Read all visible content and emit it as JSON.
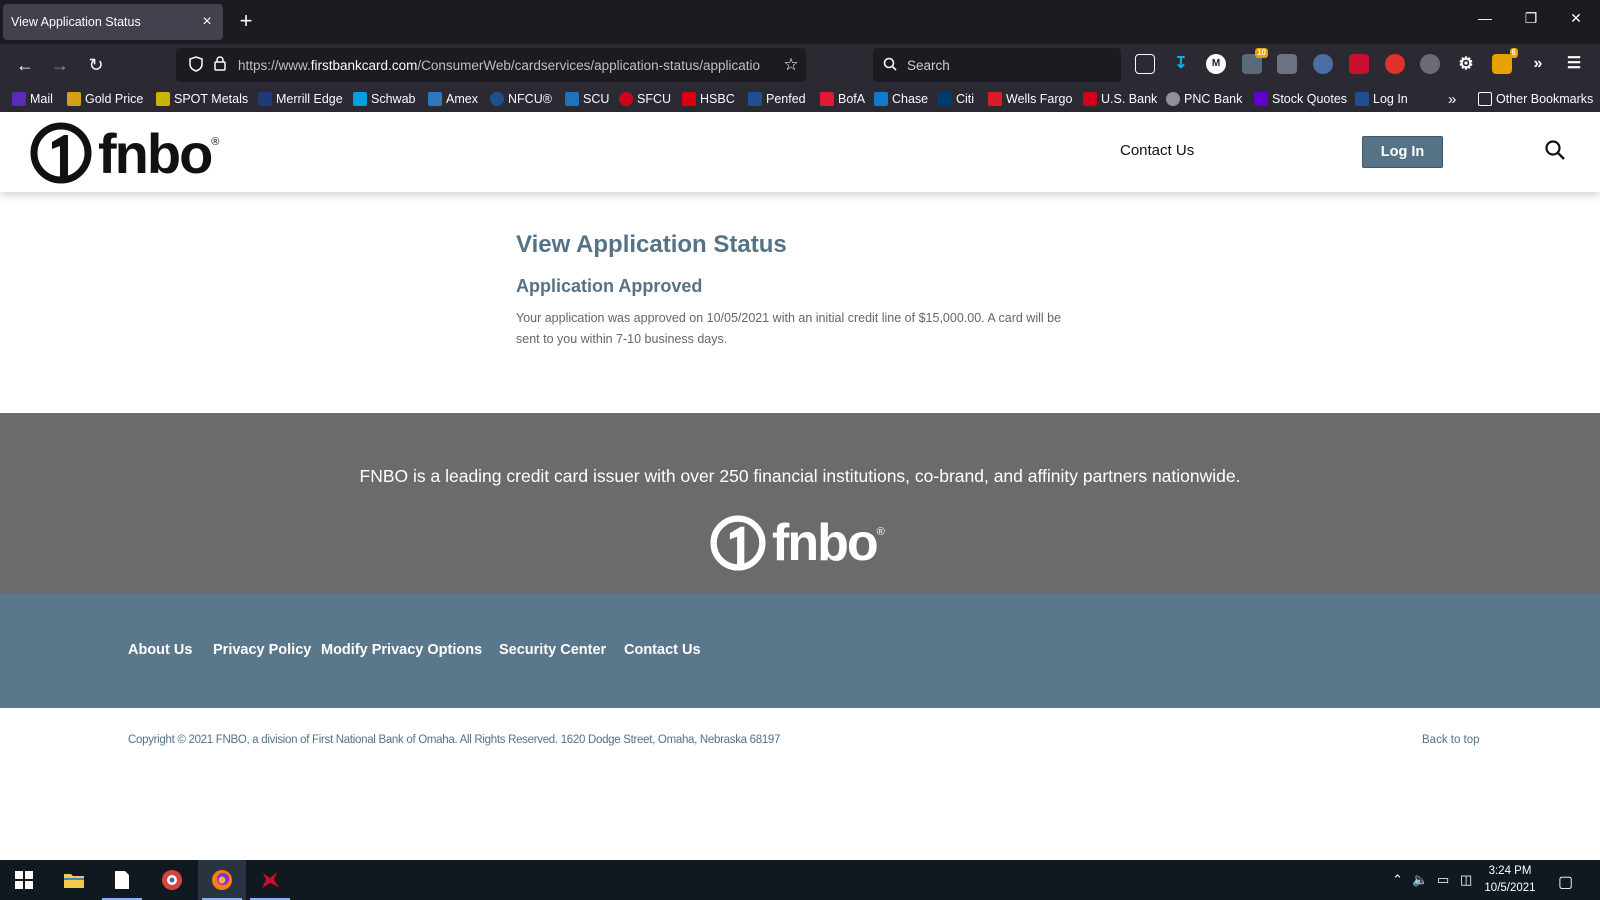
{
  "browser": {
    "tab_title": "View Application Status",
    "tab_close": "×",
    "new_tab": "+",
    "url_prefix": "https://www.",
    "url_host": "firstbankcard.com",
    "url_path": "/ConsumerWeb/cardservices/application-status/applicatio",
    "search_placeholder": "Search",
    "ext_badges": {
      "weather": "10",
      "store": "6"
    },
    "bookmarks": [
      {
        "label": "Mail",
        "color": "#5b2ab8"
      },
      {
        "label": "Gold Price",
        "color": "#d4a017"
      },
      {
        "label": "SPOT Metals",
        "color": "#c9b400"
      },
      {
        "label": "Merrill Edge",
        "color": "#1f3a7a"
      },
      {
        "label": "Schwab",
        "color": "#00a0df"
      },
      {
        "label": "Amex",
        "color": "#2e77bc"
      },
      {
        "label": "NFCU®",
        "color": "#1d4f91"
      },
      {
        "label": "SCU",
        "color": "#1e73be"
      },
      {
        "label": "SFCU",
        "color": "#d0021b"
      },
      {
        "label": "HSBC",
        "color": "#db0011"
      },
      {
        "label": "Penfed",
        "color": "#1d4f91"
      },
      {
        "label": "BofA",
        "color": "#e31837"
      },
      {
        "label": "Chase",
        "color": "#117aca"
      },
      {
        "label": "Citi",
        "color": "#003b70"
      },
      {
        "label": "Wells Fargo",
        "color": "#d71e28"
      },
      {
        "label": "U.S. Bank",
        "color": "#d0021b"
      },
      {
        "label": "PNC Bank",
        "color": "#8f8f9d"
      },
      {
        "label": "Stock Quotes",
        "color": "#6001d2"
      },
      {
        "label": "Log In",
        "color": "#1d4f91"
      }
    ],
    "other_bookmarks": "Other Bookmarks"
  },
  "header": {
    "logo_text": "fnbo",
    "logo_reg": "®",
    "contact_label": "Contact Us",
    "login_label": "Log In"
  },
  "main": {
    "title": "View Application Status",
    "subtitle": "Application Approved",
    "message": "Your application was approved on 10/05/2021 with an initial credit line of $15,000.00. A card will be sent to you within 7-10 business days."
  },
  "footer": {
    "tagline": "FNBO is a leading credit card issuer with over 250 financial institutions, co-brand, and affinity partners nationwide.",
    "logo_text": "fnbo",
    "logo_reg": "®",
    "links": [
      "About Us",
      "Privacy Policy",
      "Modify Privacy Options",
      "Security Center",
      "Contact Us"
    ],
    "copyright": "Copyright © 2021 FNBO, a division of First National Bank of Omaha. All Rights Reserved. 1620 Dodge Street, Omaha, Nebraska 68197",
    "back_to_top": "Back to top"
  },
  "taskbar": {
    "time": "3:24 PM",
    "date": "10/5/2021"
  },
  "colors": {
    "brand_slate": "#557287",
    "footer_gray": "#6b6b6b",
    "footer_blue": "#5a778b",
    "browser_dark": "#1c1b22",
    "browser_toolbar": "#2b2a33"
  }
}
